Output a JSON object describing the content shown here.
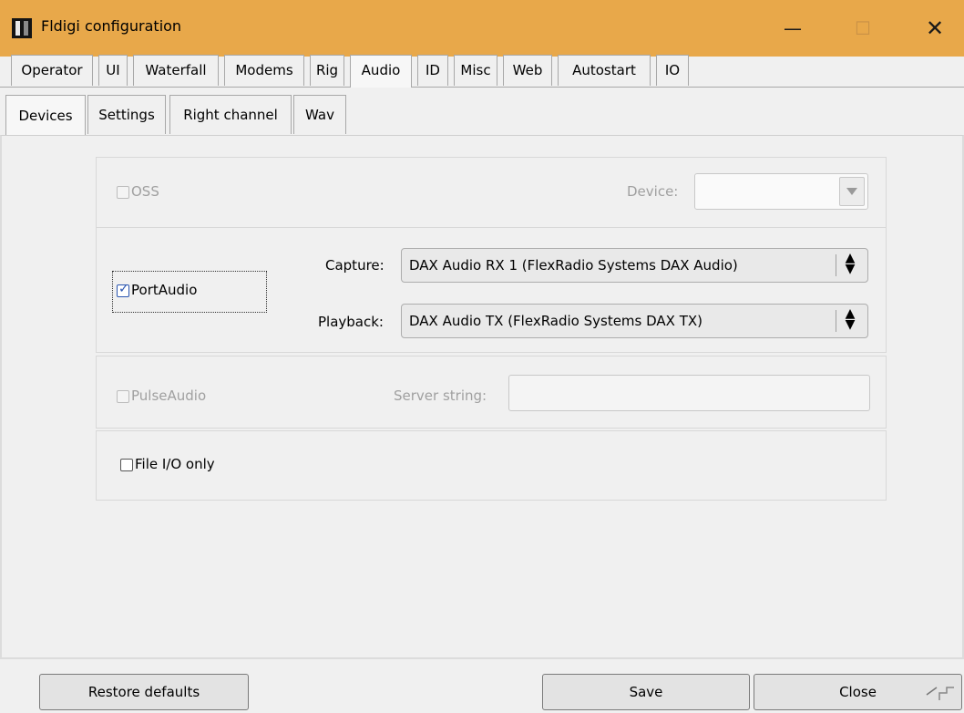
{
  "window": {
    "title": "Fldigi configuration",
    "minimize_glyph": "—",
    "maximize_glyph": "☐",
    "close_glyph": "✕"
  },
  "main_tabs": [
    "Operator",
    "UI",
    "Waterfall",
    "Modems",
    "Rig",
    "Audio",
    "ID",
    "Misc",
    "Web",
    "Autostart",
    "IO"
  ],
  "main_tabs_active": "Audio",
  "sub_tabs": [
    "Devices",
    "Settings",
    "Right channel",
    "Wav"
  ],
  "sub_tabs_active": "Devices",
  "oss": {
    "label": "OSS",
    "checked": false,
    "enabled": false,
    "device_label": "Device:",
    "device_value": ""
  },
  "portaudio": {
    "label": "PortAudio",
    "checked": true,
    "enabled": true,
    "capture_label": "Capture:",
    "capture_value": "DAX Audio RX 1 (FlexRadio Systems DAX Audio)",
    "playback_label": "Playback:",
    "playback_value": "DAX Audio TX (FlexRadio Systems DAX TX)"
  },
  "pulseaudio": {
    "label": "PulseAudio",
    "checked": false,
    "enabled": false,
    "server_label": "Server string:",
    "server_value": ""
  },
  "file_io": {
    "label": "File I/O only",
    "checked": false
  },
  "buttons": {
    "restore": "Restore defaults",
    "save": "Save",
    "close": "Close"
  },
  "colors": {
    "titlebar": "#e8a84a",
    "window_bg": "#f0f0f0",
    "check_accent": "#2a55b0"
  },
  "icons": {
    "app": "fldigi-app-icon",
    "dropdown": "chevron-down-icon",
    "spinner": "up-down-arrows-icon",
    "grip": "resize-grip-icon"
  }
}
